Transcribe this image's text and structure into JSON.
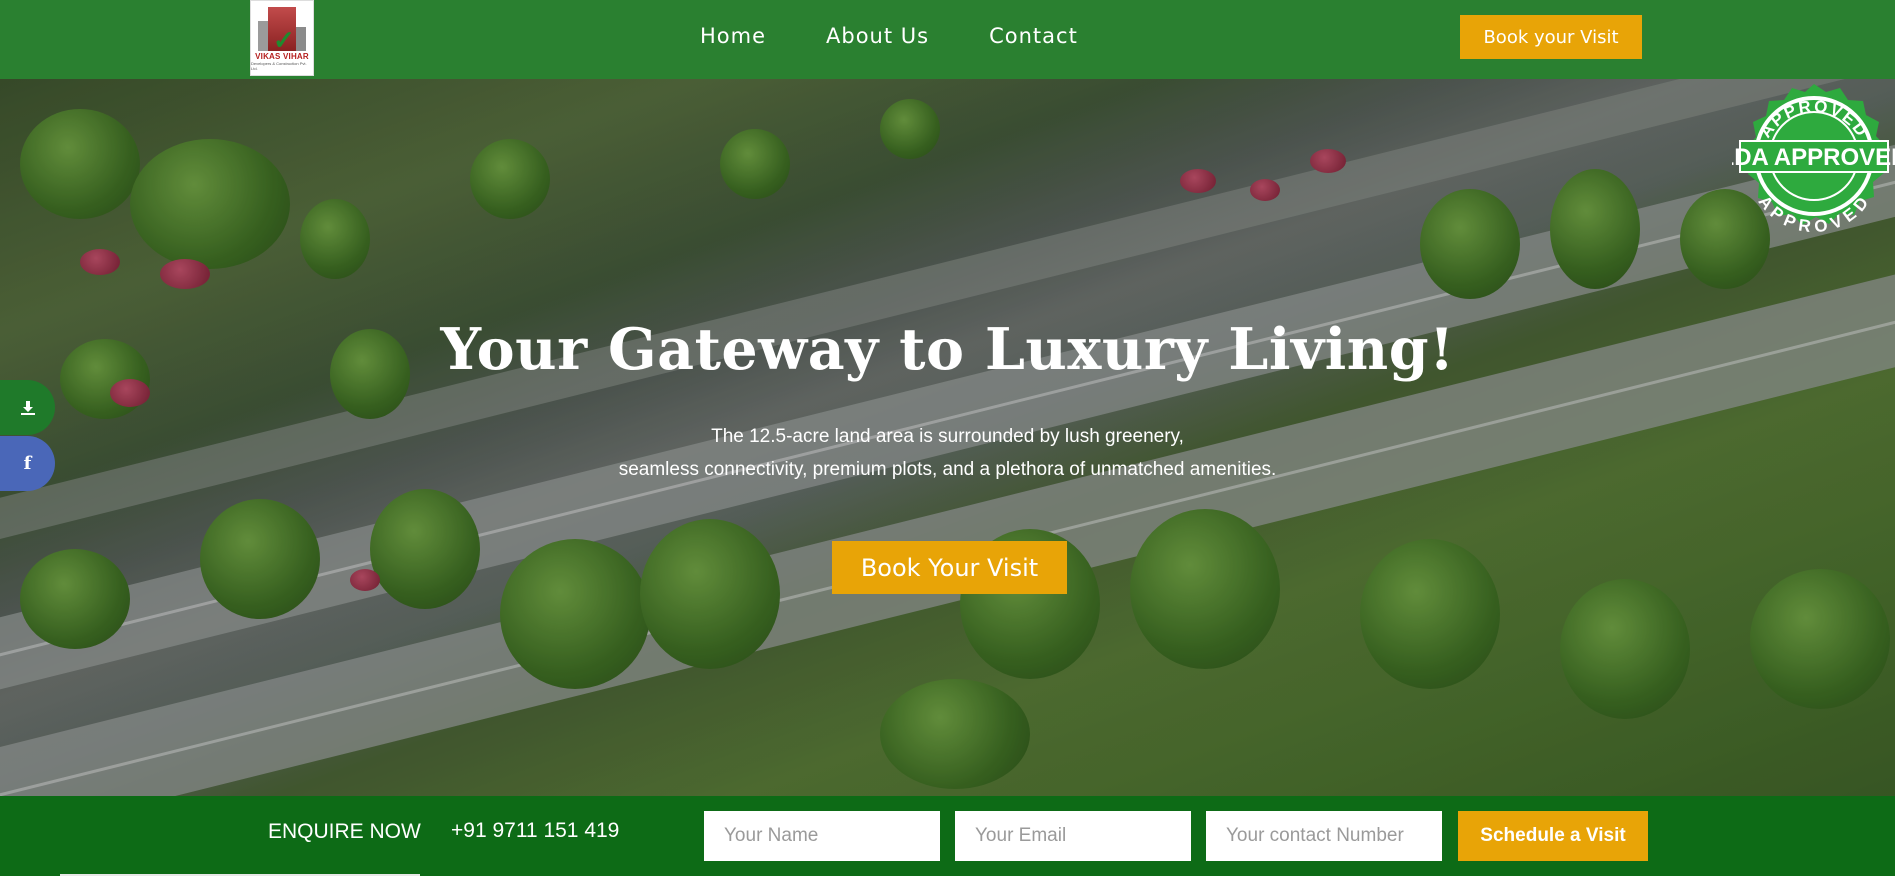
{
  "header": {
    "logo_text": "VIKAS VIHAR",
    "logo_subtext": "Developers & Construction Pvt. Ltd.",
    "nav": [
      {
        "label": "Home"
      },
      {
        "label": "About Us"
      },
      {
        "label": "Contact"
      }
    ],
    "cta_label": "Book your Visit"
  },
  "stamp": {
    "top_text": "APPROVED",
    "center_text": "LDA APPROVED",
    "bottom_text": "APPROVED",
    "color": "#2eaa3e"
  },
  "hero": {
    "title": "Your Gateway to Luxury Living!",
    "subtitle_line1": "The 12.5-acre land area is surrounded by lush greenery,",
    "subtitle_line2": "seamless connectivity, premium plots, and a plethora of unmatched amenities.",
    "cta_label": "Book Your Visit"
  },
  "side_buttons": [
    {
      "icon": "download-icon"
    },
    {
      "icon": "facebook-icon",
      "glyph": "f"
    }
  ],
  "enquiry": {
    "label": "ENQUIRE NOW",
    "phone": "+91 9711 151 419",
    "name_placeholder": "Your Name",
    "email_placeholder": "Your Email",
    "contact_placeholder": "Your contact Number",
    "submit_label": "Schedule a Visit"
  },
  "colors": {
    "nav_green": "#2a8030",
    "bar_green": "#0d6b16",
    "accent_orange": "#e8a407"
  }
}
